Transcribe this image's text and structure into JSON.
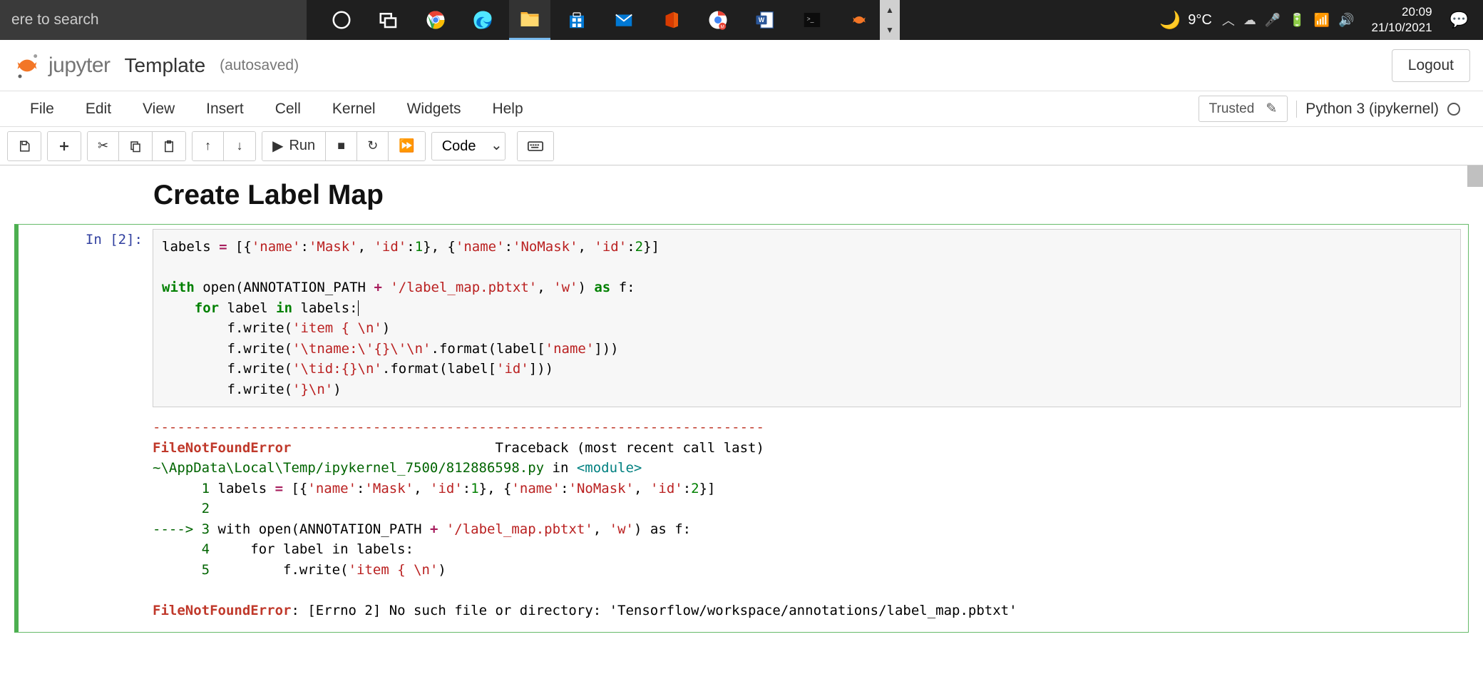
{
  "taskbar": {
    "search_placeholder": "ere to search",
    "weather_temp": "9°C",
    "time": "20:09",
    "date": "21/10/2021"
  },
  "header": {
    "logo_text": "jupyter",
    "notebook_name": "Template",
    "autosaved": "(autosaved)",
    "logout": "Logout"
  },
  "menu": {
    "file": "File",
    "edit": "Edit",
    "view": "View",
    "insert": "Insert",
    "cell": "Cell",
    "kernel": "Kernel",
    "widgets": "Widgets",
    "help": "Help",
    "trusted": "Trusted",
    "kernel_name": "Python 3 (ipykernel)"
  },
  "toolbar": {
    "run_label": "Run",
    "cell_type": "Code"
  },
  "heading": "Create Label Map",
  "cell": {
    "prompt": "In [2]:",
    "code": {
      "l1a": "labels ",
      "l1b": "=",
      "l1c": " [{",
      "l1d": "'name'",
      "l1e": ":",
      "l1f": "'Mask'",
      "l1g": ", ",
      "l1h": "'id'",
      "l1i": ":",
      "l1j": "1",
      "l1k": "}, {",
      "l1l": "'name'",
      "l1m": ":",
      "l1n": "'NoMask'",
      "l1o": ", ",
      "l1p": "'id'",
      "l1q": ":",
      "l1r": "2",
      "l1s": "}]",
      "l3a": "with",
      "l3b": " open(ANNOTATION_PATH ",
      "l3c": "+",
      "l3d": " ",
      "l3e": "'/label_map.pbtxt'",
      "l3f": ", ",
      "l3g": "'w'",
      "l3h": ") ",
      "l3i": "as",
      "l3j": " f:",
      "l4a": "    ",
      "l4b": "for",
      "l4c": " label ",
      "l4d": "in",
      "l4e": " labels:",
      "l5a": "        f.write(",
      "l5b": "'item { \\n'",
      "l5c": ")",
      "l6a": "        f.write(",
      "l6b": "'\\tname:\\'{}\\'\\n'",
      "l6c": ".format(label[",
      "l6d": "'name'",
      "l6e": "]))",
      "l7a": "        f.write(",
      "l7b": "'\\tid:{}\\n'",
      "l7c": ".format(label[",
      "l7d": "'id'",
      "l7e": "]))",
      "l8a": "        f.write(",
      "l8b": "'}\\n'",
      "l8c": ")"
    },
    "output": {
      "sep": "---------------------------------------------------------------------------",
      "err_name": "FileNotFoundError",
      "tb_label": "                         Traceback (most recent call last)",
      "path": "~\\AppData\\Local\\Temp/ipykernel_7500/812886598.py",
      "in": " in ",
      "module": "<module>",
      "ln1_num": "      1",
      "ln1_a": " labels ",
      "ln1_b": "=",
      "ln1_c": " [{",
      "ln1_d": "'name'",
      "ln1_e": ":",
      "ln1_f": "'Mask'",
      "ln1_g": ", ",
      "ln1_h": "'id'",
      "ln1_i": ":",
      "ln1_j": "1",
      "ln1_k": "}, {",
      "ln1_l": "'name'",
      "ln1_m": ":",
      "ln1_n": "'NoMask'",
      "ln1_o": ", ",
      "ln1_p": "'id'",
      "ln1_q": ":",
      "ln1_r": "2",
      "ln1_s": "}]",
      "ln2": "      2 ",
      "ln3_arrow": "----> 3",
      "ln3_a": " with open",
      "ln3_b": "(",
      "ln3_c": "ANNOTATION_PATH ",
      "ln3_d": "+",
      "ln3_e": " ",
      "ln3_f": "'/label_map.pbtxt'",
      "ln3_g": ",",
      "ln3_h": " ",
      "ln3_i": "'w'",
      "ln3_j": ")",
      "ln3_k": " as f",
      "ln3_l": ":",
      "ln4_num": "      4",
      "ln4_a": "     for label in labels",
      "ln4_b": ":",
      "ln5_num": "      5",
      "ln5_a": "         f",
      "ln5_b": ".",
      "ln5_c": "write",
      "ln5_d": "(",
      "ln5_e": "'item { \\n'",
      "ln5_f": ")",
      "final_err": "FileNotFoundError",
      "final_msg": ": [Errno 2] No such file or directory: 'Tensorflow/workspace/annotations/label_map.pbtxt'"
    }
  }
}
